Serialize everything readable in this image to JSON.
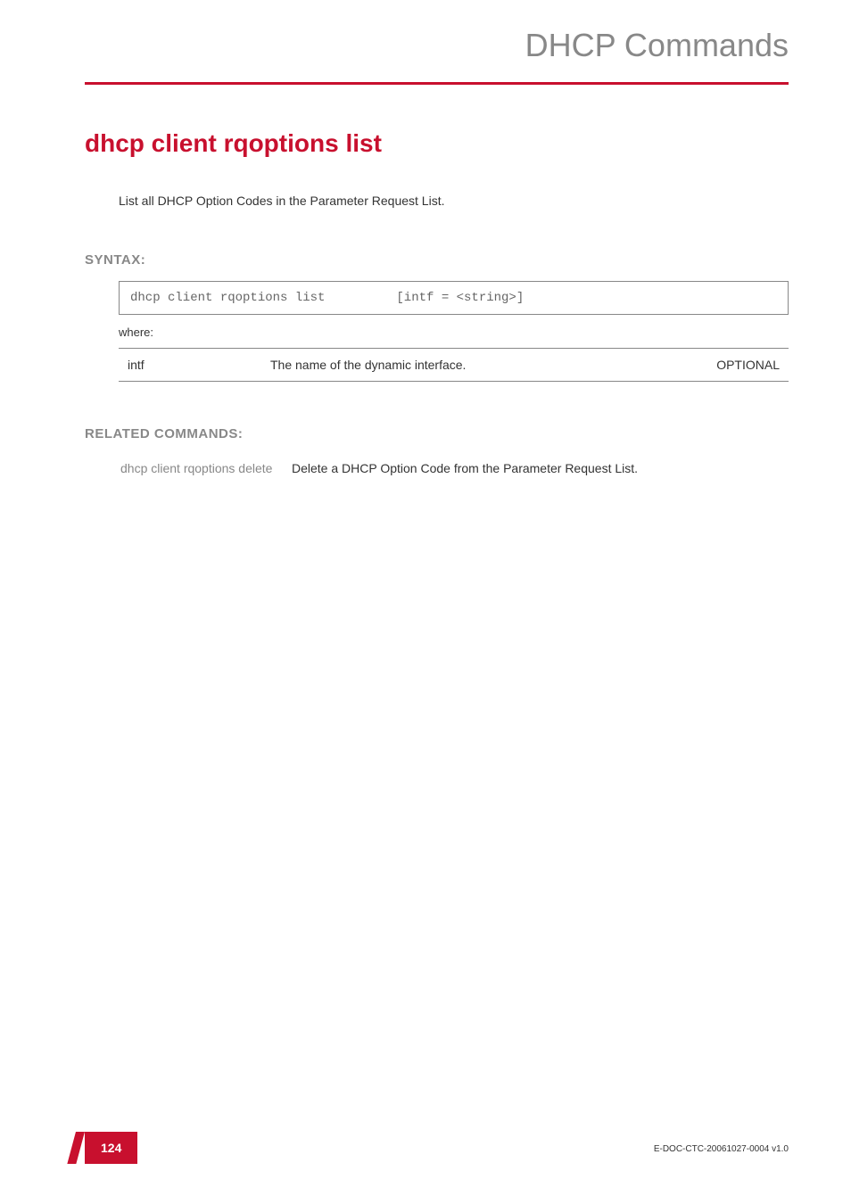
{
  "header": {
    "chapter_title": "DHCP Commands"
  },
  "command": {
    "title": "dhcp client rqoptions list",
    "description": "List all DHCP Option Codes in the Parameter Request List."
  },
  "syntax": {
    "heading": "SYNTAX:",
    "command": "dhcp client rqoptions list",
    "args": "[intf = <string>]",
    "where_label": "where:",
    "params": [
      {
        "name": "intf",
        "description": "The name of the dynamic interface.",
        "requirement": "OPTIONAL"
      }
    ]
  },
  "related": {
    "heading": "RELATED COMMANDS:",
    "items": [
      {
        "command": "dhcp client rqoptions delete",
        "description": "Delete a DHCP Option Code from the Parameter Request List."
      }
    ]
  },
  "footer": {
    "page_number": "124",
    "doc_id": "E-DOC-CTC-20061027-0004 v1.0"
  }
}
